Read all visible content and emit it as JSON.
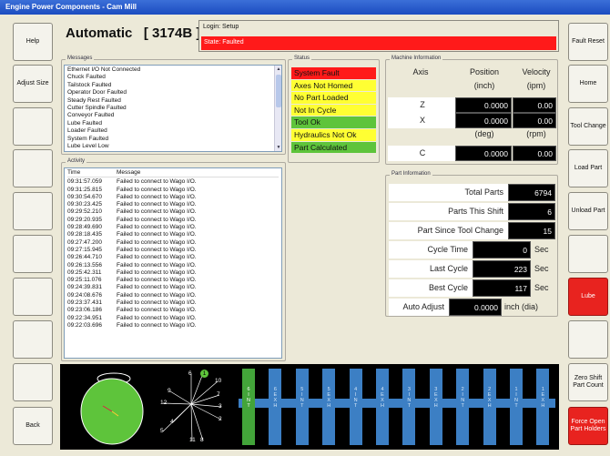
{
  "window_title": "Engine Power Components - Cam Mill",
  "left_buttons": [
    "Help",
    "Adjust Size",
    "",
    "",
    "",
    "",
    "",
    "",
    "",
    "Back"
  ],
  "right_buttons": [
    {
      "label": "Fault Reset",
      "red": false
    },
    {
      "label": "Home",
      "red": false
    },
    {
      "label": "Tool Change",
      "red": false
    },
    {
      "label": "Load Part",
      "red": false
    },
    {
      "label": "Unload Part",
      "red": false
    },
    {
      "label": "",
      "red": false
    },
    {
      "label": "Lube",
      "red": true
    },
    {
      "label": "",
      "red": false
    },
    {
      "label": "Zero Shift Part Count",
      "red": false
    },
    {
      "label": "Force Open Part Holders",
      "red": true
    }
  ],
  "mode": {
    "title": "Automatic   [ 3174B ]"
  },
  "login": {
    "label": "Login: Setup",
    "state": "State: Faulted"
  },
  "messages": {
    "title": "Messages",
    "items": [
      "Ethernet I/O Not Connected",
      "Chuck Faulted",
      "Tailstock Faulted",
      "Operator Door Faulted",
      "Steady Rest Faulted",
      "Cutter Spindle Faulted",
      "Conveyor Faulted",
      "Lube Faulted",
      "Loader Faulted",
      "System Faulted",
      "Lube Level Low"
    ]
  },
  "activity": {
    "title": "Activity",
    "col_time": "Time",
    "col_message": "Message",
    "rows": [
      {
        "time": "09:31:57.059",
        "msg": "Failed to connect to Wago I/O."
      },
      {
        "time": "09:31:25.815",
        "msg": "Failed to connect to Wago I/O."
      },
      {
        "time": "09:30:54.670",
        "msg": "Failed to connect to Wago I/O."
      },
      {
        "time": "09:30:23.425",
        "msg": "Failed to connect to Wago I/O."
      },
      {
        "time": "09:29:52.210",
        "msg": "Failed to connect to Wago I/O."
      },
      {
        "time": "09:29:20.935",
        "msg": "Failed to connect to Wago I/O."
      },
      {
        "time": "09:28:49.690",
        "msg": "Failed to connect to Wago I/O."
      },
      {
        "time": "09:28:18.435",
        "msg": "Failed to connect to Wago I/O."
      },
      {
        "time": "09:27:47.200",
        "msg": "Failed to connect to Wago I/O."
      },
      {
        "time": "09:27:15.945",
        "msg": "Failed to connect to Wago I/O."
      },
      {
        "time": "09:26:44.710",
        "msg": "Failed to connect to Wago I/O."
      },
      {
        "time": "09:26:13.556",
        "msg": "Failed to connect to Wago I/O."
      },
      {
        "time": "09:25:42.311",
        "msg": "Failed to connect to Wago I/O."
      },
      {
        "time": "09:25:11.076",
        "msg": "Failed to connect to Wago I/O."
      },
      {
        "time": "09:24:39.831",
        "msg": "Failed to connect to Wago I/O."
      },
      {
        "time": "09:24:08.676",
        "msg": "Failed to connect to Wago I/O."
      },
      {
        "time": "09:23:37.431",
        "msg": "Failed to connect to Wago I/O."
      },
      {
        "time": "09:23:06.186",
        "msg": "Failed to connect to Wago I/O."
      },
      {
        "time": "09:22:34.951",
        "msg": "Failed to connect to Wago I/O."
      },
      {
        "time": "09:22:03.696",
        "msg": "Failed to connect to Wago I/O."
      }
    ]
  },
  "status": {
    "title": "Status",
    "items": [
      {
        "label": "System Fault",
        "color": "red"
      },
      {
        "label": "Axes Not Homed",
        "color": "yellow"
      },
      {
        "label": "No Part Loaded",
        "color": "yellow"
      },
      {
        "label": "Not In Cycle",
        "color": "yellow"
      },
      {
        "label": "Tool Ok",
        "color": "green"
      },
      {
        "label": "Hydraulics Not Ok",
        "color": "yellow"
      },
      {
        "label": "Part Calculated",
        "color": "green"
      }
    ]
  },
  "machine": {
    "title": "Machine Information",
    "axis_header": "Axis",
    "position_header": "Position",
    "velocity_header": "Velocity",
    "pos_unit": "(inch)",
    "vel_unit": "(ipm)",
    "deg_unit": "(deg)",
    "rpm_unit": "(rpm)",
    "axes": [
      {
        "name": "Z",
        "position": "0.0000",
        "velocity": "0.00"
      },
      {
        "name": "X",
        "position": "0.0000",
        "velocity": "0.00"
      },
      {
        "name": "C",
        "position": "0.0000",
        "velocity": "0.00"
      }
    ]
  },
  "part": {
    "title": "Part Information",
    "total_label": "Total Parts",
    "total_value": "6794",
    "shift_label": "Parts This Shift",
    "shift_value": "6",
    "tool_label": "Part Since Tool Change",
    "tool_value": "15",
    "cycle_label": "Cycle Time",
    "cycle_value": "0",
    "cycle_unit": "Sec",
    "last_label": "Last Cycle",
    "last_value": "223",
    "last_unit": "Sec",
    "best_label": "Best Cycle",
    "best_value": "117",
    "best_unit": "Sec",
    "adjust_label": "Auto Adjust",
    "adjust_value": "0.0000",
    "adjust_unit": "inch (dia)"
  },
  "dial": {
    "numbers": [
      "6",
      "1",
      "10",
      "7",
      "9",
      "12",
      "3",
      "2",
      "4",
      "5",
      "11",
      "8"
    ],
    "active": "1"
  },
  "tools": [
    {
      "label": "6\nI\nN\nT",
      "active": true
    },
    {
      "label": "6\nE\nX\nH",
      "active": false
    },
    {
      "label": "5\nI\nN\nT",
      "active": false
    },
    {
      "label": "5\nE\nX\nH",
      "active": false
    },
    {
      "label": "4\nI\nN\nT",
      "active": false
    },
    {
      "label": "4\nE\nX\nH",
      "active": false
    },
    {
      "label": "3\nI\nN\nT",
      "active": false
    },
    {
      "label": "3\nE\nX\nH",
      "active": false
    },
    {
      "label": "2\nI\nN\nT",
      "active": false
    },
    {
      "label": "2\nE\nX\nH",
      "active": false
    },
    {
      "label": "1\nI\nN\nT",
      "active": false
    },
    {
      "label": "1\nE\nX\nH",
      "active": false
    }
  ],
  "colors": {
    "fault_red": "#ff1a1a",
    "warn_yellow": "#ffff33",
    "ok_green": "#5ec43b",
    "tool_blue": "#3c7fc4"
  }
}
